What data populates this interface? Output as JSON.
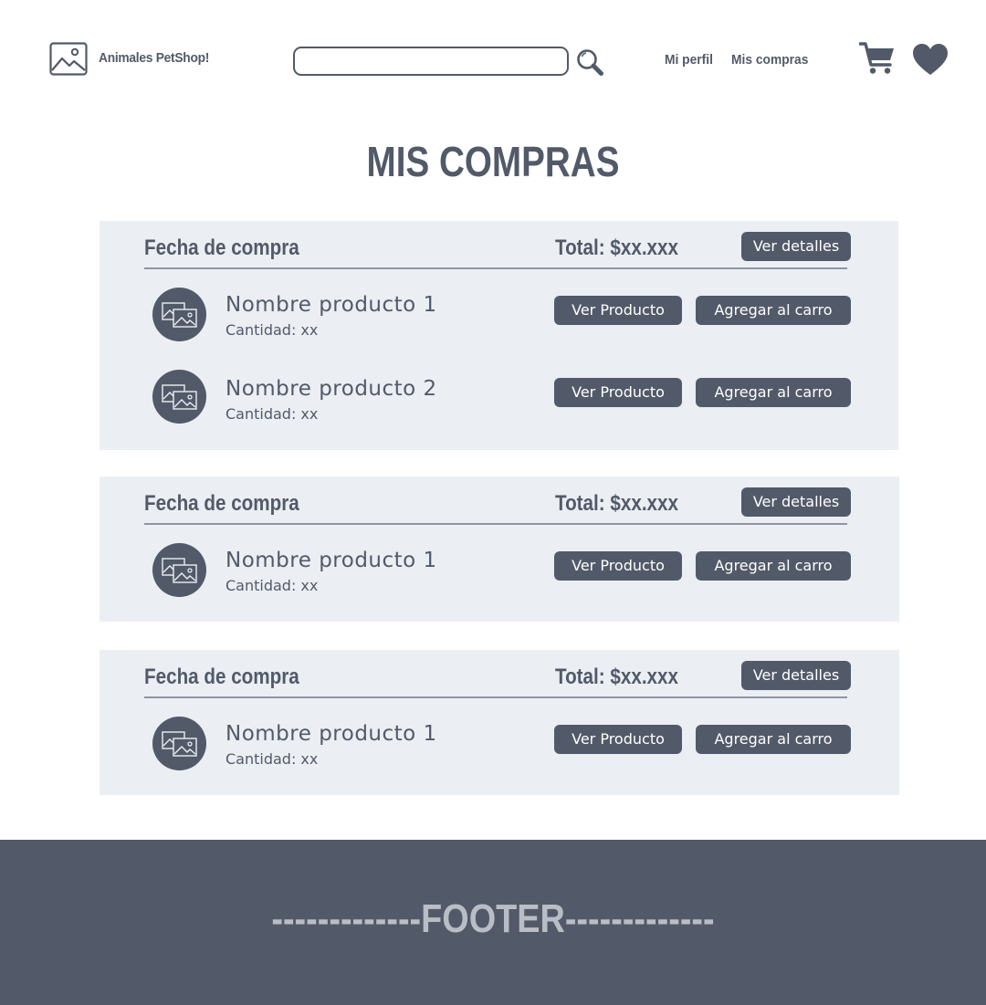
{
  "header": {
    "logo_text": "Animales PetShop!",
    "search": {
      "value": "",
      "placeholder": ""
    },
    "nav": [
      {
        "label": "Mi perfil"
      },
      {
        "label": "Mis compras"
      }
    ],
    "icons": [
      "image-icon",
      "search-icon",
      "cart-icon",
      "heart-icon"
    ]
  },
  "page_title": "MIS COMPRAS",
  "orders": [
    {
      "date_label": "Fecha de compra",
      "total_label": "Total: $xx.xxx",
      "details_button": "Ver detalles",
      "products": [
        {
          "name": "Nombre producto 1",
          "quantity": "Cantidad: xx",
          "view_button": "Ver Producto",
          "add_button": "Agregar al carro"
        },
        {
          "name": "Nombre producto 2",
          "quantity": "Cantidad: xx",
          "view_button": "Ver Producto",
          "add_button": "Agregar al carro"
        }
      ]
    },
    {
      "date_label": "Fecha de compra",
      "total_label": "Total: $xx.xxx",
      "details_button": "Ver detalles",
      "products": [
        {
          "name": "Nombre producto 1",
          "quantity": "Cantidad: xx",
          "view_button": "Ver Producto",
          "add_button": "Agregar al carro"
        }
      ]
    },
    {
      "date_label": "Fecha de compra",
      "total_label": "Total: $xx.xxx",
      "details_button": "Ver detalles",
      "products": [
        {
          "name": "Nombre producto 1",
          "quantity": "Cantidad: xx",
          "view_button": "Ver Producto",
          "add_button": "Agregar al carro"
        }
      ]
    }
  ],
  "footer": {
    "text": "-------------FOOTER-------------"
  },
  "colors": {
    "primary": "#525a69",
    "panel": "#ebeef3",
    "footer_text": "#b9bdc6",
    "white": "#ffffff"
  }
}
